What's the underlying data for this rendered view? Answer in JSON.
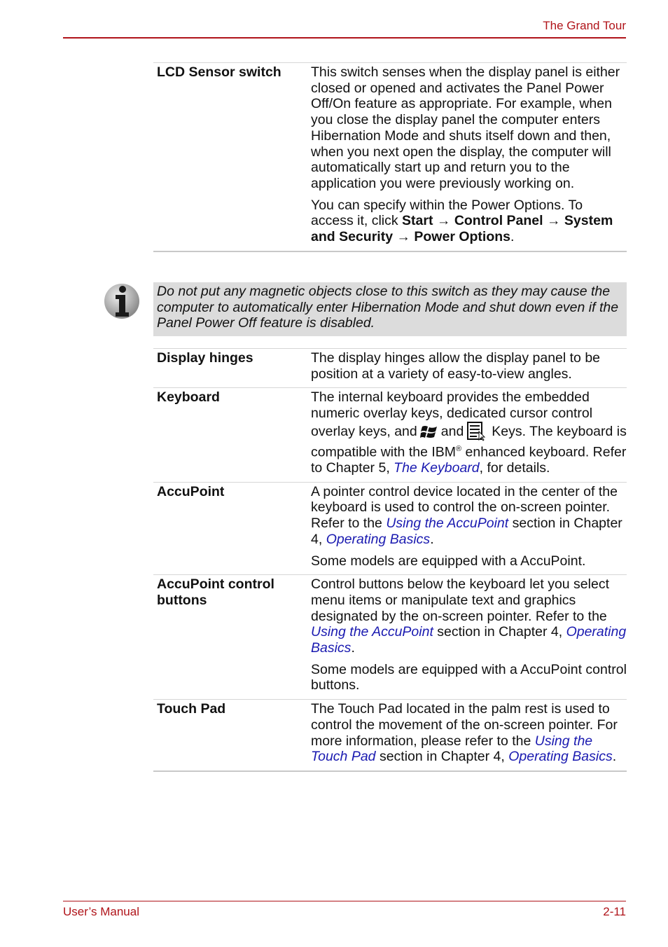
{
  "header": {
    "title": "The Grand Tour"
  },
  "footer": {
    "left": "User’s Manual",
    "right": "2-11"
  },
  "lcd": {
    "term": "LCD Sensor switch",
    "p1": "This switch senses when the display panel is either closed or opened and activates the Panel Power Off/On feature as appropriate. For example, when you close the display panel the computer enters Hibernation Mode and shuts itself down and then, when you next open the display, the computer will automatically start up and return you to the application you were previously working on.",
    "p2_pre": "You can specify within the Power Options. To access it, click ",
    "path": [
      "Start",
      "Control Panel",
      "System and Security",
      "Power Options"
    ],
    "arrow": "→",
    "p2_post": "."
  },
  "note": {
    "icon": "info-icon",
    "text": "Do not put any magnetic objects close to this switch as they may cause the computer to automatically enter Hibernation Mode and shut down even if the Panel Power Off feature is disabled."
  },
  "hinges": {
    "term": "Display hinges",
    "text": "The display hinges allow the display panel to be position at a variety of easy-to-view angles."
  },
  "keyboard": {
    "term": "Keyboard",
    "t1": "The internal keyboard provides the embedded numeric overlay keys, dedicated cursor control overlay keys, and",
    "t2": "and",
    "t3": "Keys. The keyboard is compatible with the IBM",
    "reg": "®",
    "t4": " enhanced keyboard. Refer to Chapter 5, ",
    "link": "The Keyboard",
    "t5": ", for details."
  },
  "accupoint": {
    "term": "AccuPoint",
    "t1": "A pointer control device located in the center of the keyboard is used to control the on-screen pointer. Refer to the ",
    "link1": "Using the AccuPoint",
    "t2": " section in Chapter 4, ",
    "link2": "Operating Basics",
    "t3": ".",
    "p2": "Some models are equipped with a AccuPoint."
  },
  "buttons": {
    "term": "AccuPoint control buttons",
    "t1": "Control buttons below the keyboard let you select menu items or manipulate text and graphics designated by the on-screen pointer. Refer to the ",
    "link1": "Using the AccuPoint",
    "t2": " section in Chapter 4, ",
    "link2": "Operating Basics",
    "t3": ".",
    "p2": "Some models are equipped with a AccuPoint control buttons."
  },
  "touchpad": {
    "term": "Touch Pad",
    "t1": "The Touch Pad located in the palm rest is used to control the movement of the on-screen pointer. For more information, please refer to the ",
    "link1": "Using the Touch Pad",
    "t2": " section in Chapter 4, ",
    "link2": "Operating Basics",
    "t3": "."
  }
}
